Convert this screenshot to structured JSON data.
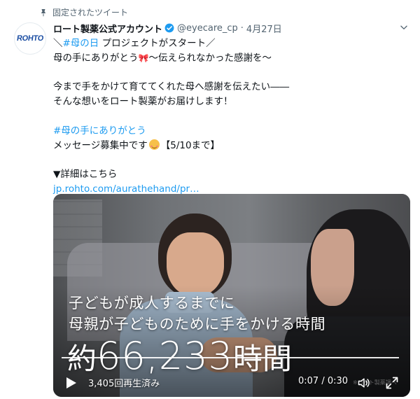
{
  "pinned_label": "固定されたツイート",
  "account": {
    "avatar_text": "ROHTO",
    "name": "ロート製薬公式アカウント",
    "handle": "@eyecare_cp",
    "separator": "·",
    "date": "4月27日"
  },
  "tweet": {
    "line1_pre": "＼",
    "line1_tag": "#母の日",
    "line1_post": " プロジェクトがスタート／",
    "line2_pre": "母の手にありがとう",
    "line2_emoji": "🎀",
    "line2_post": "～伝えられなかった感謝を～",
    "line3": "今まで手をかけて育ててくれた母へ感謝を伝えたい――",
    "line4": "そんな想いをロート製薬がお届けします！",
    "line5_tag": "#母の手にありがとう",
    "line6_pre": "メッセージ募集中です",
    "line6_post": "【5/10まで】",
    "line7": "▼詳細はこちら",
    "link": "jp.rohto.com/aurathehand/pr…"
  },
  "video": {
    "caption1": "子どもが成人するまでに",
    "caption2": "母親が子どものために手をかける時間",
    "big_prefix": "約",
    "big_number": "66,233",
    "big_suffix": "時間",
    "views": "3,405回再生済み",
    "time": "0:07 / 0:30",
    "watermark": "※ロート製薬調べ"
  },
  "colors": {
    "link": "#1d9bf0",
    "secondary_text": "#536471",
    "brand_blue": "#1d4fa3"
  },
  "icons": {
    "pin": "pin-icon",
    "verified": "verified-badge-icon",
    "more": "chevron-down-icon",
    "play": "play-icon",
    "volume": "volume-icon",
    "fullscreen": "fullscreen-icon"
  }
}
